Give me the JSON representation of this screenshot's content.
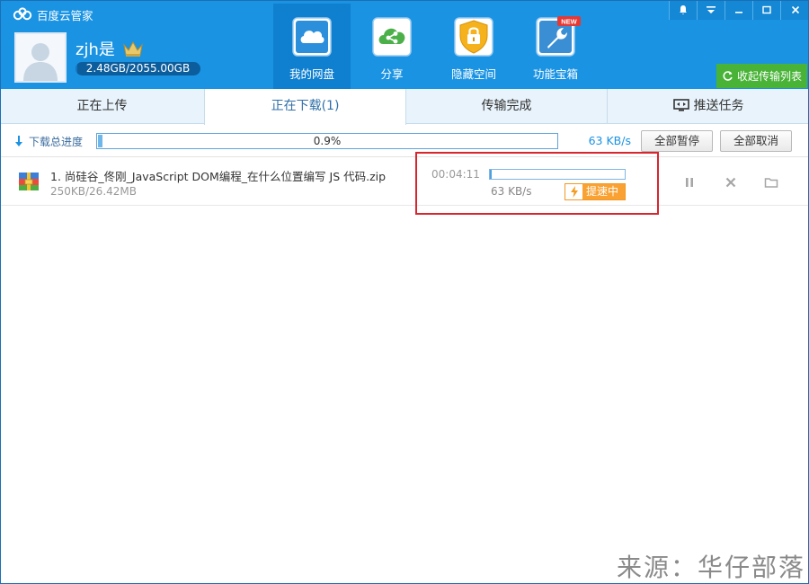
{
  "app": {
    "title": "百度云管家"
  },
  "user": {
    "name": "zjh是",
    "quota_text": "2.48GB/2055.00GB",
    "quota_used_fraction": 0.0012
  },
  "nav": [
    {
      "label": "我的网盘",
      "icon": "cloud-icon",
      "active": true
    },
    {
      "label": "分享",
      "icon": "share-icon",
      "active": false
    },
    {
      "label": "隐藏空间",
      "icon": "lock-icon",
      "active": false
    },
    {
      "label": "功能宝箱",
      "icon": "wrench-icon",
      "badge": "NEW",
      "active": false
    }
  ],
  "window_controls": [
    "bell-icon",
    "menu-icon",
    "minimize-icon",
    "maximize-icon",
    "close-icon"
  ],
  "collapse_button": {
    "label": "收起传输列表"
  },
  "tabs": [
    {
      "label": "正在上传",
      "active": false
    },
    {
      "label": "正在下载(1)",
      "active": true
    },
    {
      "label": "传输完成",
      "active": false
    },
    {
      "label": "推送任务",
      "active": false,
      "icon": "screen-icon"
    }
  ],
  "progress": {
    "label": "下载总进度",
    "percent_text": "0.9%",
    "percent_value": 0.9,
    "speed": "63 KB/s",
    "pause_all": "全部暂停",
    "cancel_all": "全部取消"
  },
  "file": {
    "name": "1. 尚硅谷_佟刚_JavaScript DOM编程_在什么位置编写 JS 代码.zip",
    "size": "250KB/26.42MB",
    "time_left": "00:04:11",
    "speed": "63 KB/s",
    "progress_value": 0.9,
    "boost_label": "提速中"
  },
  "watermark": "来源：华仔部落",
  "colors": {
    "header": "#1a93e3",
    "active_nav": "#0f7fd0",
    "accent_green": "#48b337",
    "boost": "#f9a233",
    "highlight": "#d8262f"
  }
}
